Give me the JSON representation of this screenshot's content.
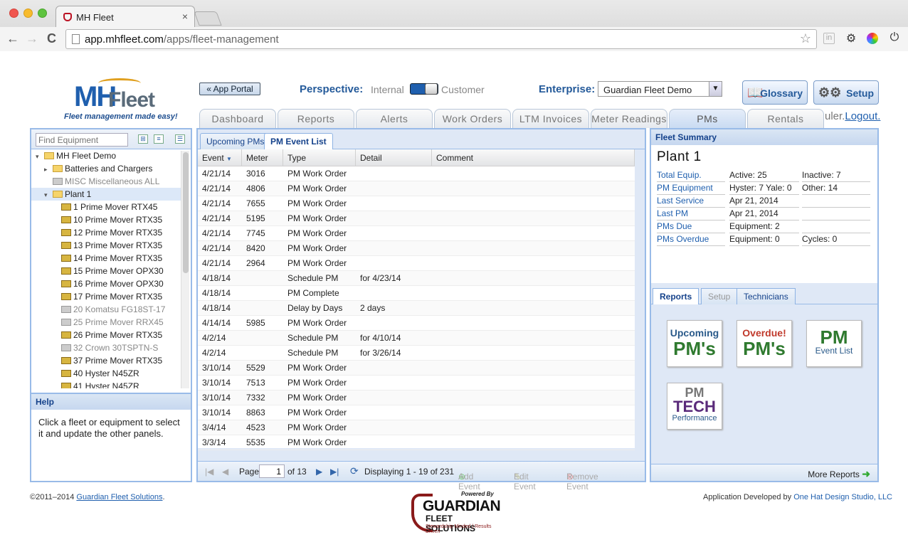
{
  "browser": {
    "tab_title": "MH Fleet",
    "tab_close": "×",
    "url_host": "app.mhfleet.com",
    "url_path": "/apps/fleet-management",
    "back": "←",
    "forward": "→",
    "reload": "C",
    "star": "☆"
  },
  "logo": {
    "mh": "MH",
    "fleet": "Fleet",
    "tagline": "Fleet management made easy!"
  },
  "header": {
    "app_portal": "« App Portal",
    "perspective_label": "Perspective:",
    "perspective_internal": "Internal",
    "perspective_customer": "Customer",
    "enterprise_label": "Enterprise:",
    "enterprise_value": "Guardian Fleet Demo",
    "glossary": "Glossary",
    "setup": "Setup",
    "logout_prefix": "uler.",
    "logout": "Logout."
  },
  "main_tabs": [
    "Dashboard",
    "Reports",
    "Alerts",
    "Work Orders",
    "LTM Invoices",
    "Meter Readings",
    "PMs",
    "Rentals"
  ],
  "left": {
    "find_placeholder": "Find Equipment",
    "tree": [
      {
        "label": "MH Fleet Demo",
        "type": "folder",
        "indent": 0,
        "expand": "▾"
      },
      {
        "label": "Batteries and Chargers",
        "type": "folder",
        "indent": 1,
        "expand": "▸"
      },
      {
        "label": "MISC Miscellaneous ALL",
        "type": "equip-grey",
        "indent": 1,
        "expand": ""
      },
      {
        "label": "Plant 1",
        "type": "folder",
        "indent": 1,
        "expand": "▾",
        "selected": true
      },
      {
        "label": "1 Prime Mover RTX45",
        "type": "equip",
        "indent": 2,
        "expand": ""
      },
      {
        "label": "10 Prime Mover RTX35",
        "type": "equip",
        "indent": 2,
        "expand": ""
      },
      {
        "label": "12 Prime Mover RTX35",
        "type": "equip",
        "indent": 2,
        "expand": ""
      },
      {
        "label": "13 Prime Mover RTX35",
        "type": "equip",
        "indent": 2,
        "expand": ""
      },
      {
        "label": "14 Prime Mover RTX35",
        "type": "equip",
        "indent": 2,
        "expand": ""
      },
      {
        "label": "15 Prime Mover OPX30",
        "type": "equip",
        "indent": 2,
        "expand": ""
      },
      {
        "label": "16 Prime Mover OPX30",
        "type": "equip",
        "indent": 2,
        "expand": ""
      },
      {
        "label": "17 Prime Mover RTX35",
        "type": "equip",
        "indent": 2,
        "expand": ""
      },
      {
        "label": "20 Komatsu FG18ST-17",
        "type": "equip-grey",
        "indent": 2,
        "expand": ""
      },
      {
        "label": "25 Prime Mover RRX45",
        "type": "equip-grey",
        "indent": 2,
        "expand": ""
      },
      {
        "label": "26 Prime Mover RTX35",
        "type": "equip",
        "indent": 2,
        "expand": ""
      },
      {
        "label": "32 Crown 30TSPTN-S",
        "type": "equip-grey",
        "indent": 2,
        "expand": ""
      },
      {
        "label": "37 Prime Mover RTX35",
        "type": "equip",
        "indent": 2,
        "expand": ""
      },
      {
        "label": "40 Hyster N45ZR",
        "type": "equip",
        "indent": 2,
        "expand": ""
      },
      {
        "label": "41 Hyster N45ZR",
        "type": "equip",
        "indent": 2,
        "expand": ""
      }
    ],
    "help_title": "Help",
    "help_text": "Click a fleet or equipment to select it and update the other panels."
  },
  "center": {
    "subtabs": [
      "Upcoming PMs",
      "PM Event List"
    ],
    "columns": [
      "Event",
      "Meter",
      "Type",
      "Detail",
      "Comment"
    ],
    "rows": [
      [
        "4/21/14",
        "3016",
        "PM Work Order",
        "",
        ""
      ],
      [
        "4/21/14",
        "4806",
        "PM Work Order",
        "",
        ""
      ],
      [
        "4/21/14",
        "7655",
        "PM Work Order",
        "",
        ""
      ],
      [
        "4/21/14",
        "5195",
        "PM Work Order",
        "",
        ""
      ],
      [
        "4/21/14",
        "7745",
        "PM Work Order",
        "",
        ""
      ],
      [
        "4/21/14",
        "8420",
        "PM Work Order",
        "",
        ""
      ],
      [
        "4/21/14",
        "2964",
        "PM Work Order",
        "",
        ""
      ],
      [
        "4/18/14",
        "",
        "Schedule PM",
        "for 4/23/14",
        ""
      ],
      [
        "4/18/14",
        "",
        "PM Complete",
        "",
        ""
      ],
      [
        "4/18/14",
        "",
        "Delay by Days",
        "2 days",
        ""
      ],
      [
        "4/14/14",
        "5985",
        "PM Work Order",
        "",
        ""
      ],
      [
        "4/2/14",
        "",
        "Schedule PM",
        "for 4/10/14",
        ""
      ],
      [
        "4/2/14",
        "",
        "Schedule PM",
        "for 3/26/14",
        ""
      ],
      [
        "3/10/14",
        "5529",
        "PM Work Order",
        "",
        ""
      ],
      [
        "3/10/14",
        "7513",
        "PM Work Order",
        "",
        ""
      ],
      [
        "3/10/14",
        "7332",
        "PM Work Order",
        "",
        ""
      ],
      [
        "3/10/14",
        "8863",
        "PM Work Order",
        "",
        ""
      ],
      [
        "3/4/14",
        "4523",
        "PM Work Order",
        "",
        ""
      ],
      [
        "3/3/14",
        "5535",
        "PM Work Order",
        "",
        ""
      ]
    ],
    "pager": {
      "page_label": "Page",
      "page_value": "1",
      "of_pages": "of 13",
      "displaying": "Displaying 1 - 19 of 231",
      "add_event": "Add Event",
      "edit_event": "Edit Event",
      "remove_event": "Remove Event"
    }
  },
  "right": {
    "summary_title": "Fleet Summary",
    "plant": "Plant 1",
    "rows": [
      {
        "k": "Total Equip.",
        "v1": "Active: 25",
        "v2": "Inactive: 7"
      },
      {
        "k": "PM Equipment",
        "v1": "Hyster: 7   Yale: 0",
        "v2": "Other: 14"
      },
      {
        "k": "Last Service",
        "v1": "Apr 21, 2014",
        "v2": ""
      },
      {
        "k": "Last PM",
        "v1": "Apr 21, 2014",
        "v2": ""
      },
      {
        "k": "PMs Due",
        "v1": "Equipment: 2",
        "v2": ""
      },
      {
        "k": "PMs Overdue",
        "v1": "Equipment: 0",
        "v2": "Cycles: 0"
      }
    ],
    "tabs": [
      "Reports",
      "Setup",
      "Technicians"
    ],
    "reports": {
      "upcoming_a": "Upcoming",
      "upcoming_b": "PM's",
      "overdue_a": "Overdue!",
      "overdue_b": "PM's",
      "eventlist_a": "PM",
      "eventlist_b": "Event List",
      "tech_a": "PM",
      "tech_b": "TECH",
      "tech_c": "Performance"
    },
    "more_reports": "More Reports"
  },
  "footer": {
    "copyright": "©2011–2014 ",
    "company": "Guardian Fleet Solutions",
    "period": ".",
    "powered": "Powered By",
    "g1": "GUARDIAN",
    "g2": "FLEET SOLUTIONS",
    "g3": "Stewardship Minded | Results Driven",
    "dev_prefix": "Application Developed by ",
    "dev": "One Hat Design Studio, LLC"
  },
  "colors": {
    "accent": "#1f5fae",
    "panel_border": "#99bbe8",
    "panel_header": "#15428b"
  }
}
